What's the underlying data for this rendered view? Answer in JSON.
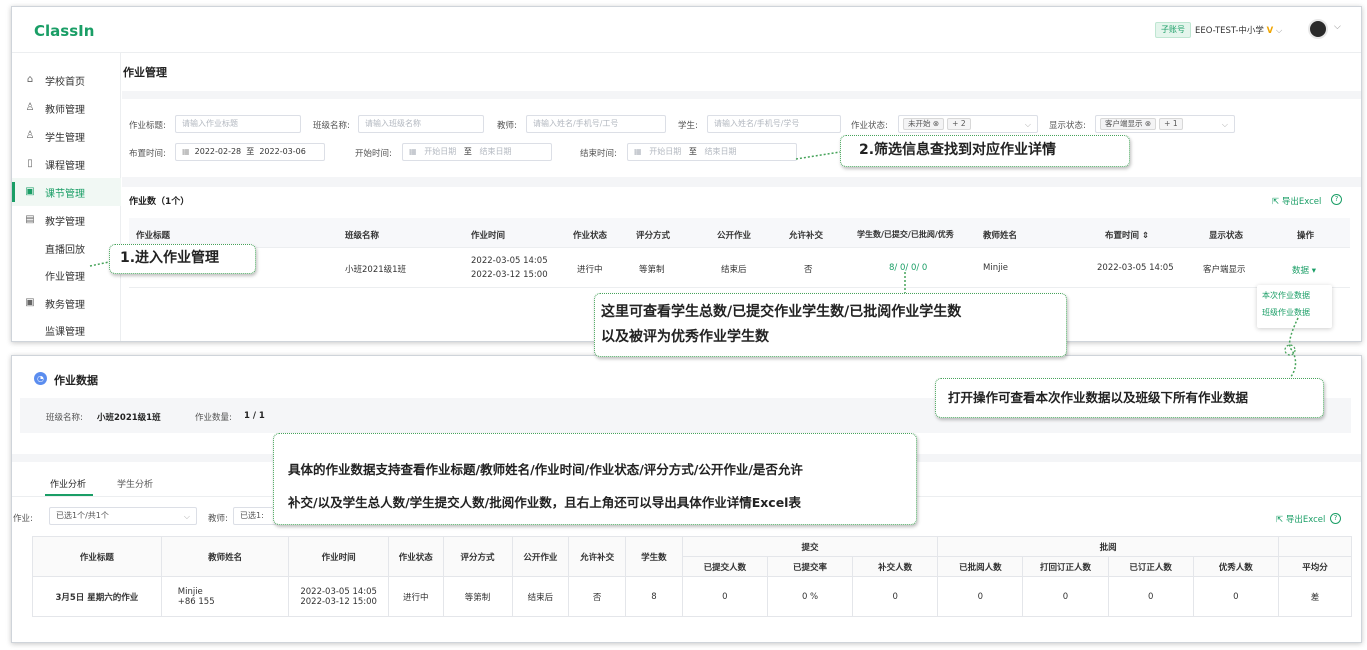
{
  "app": {
    "logo": "ClassIn"
  },
  "topbar": {
    "badge": "子账号",
    "org": "EEO-TEST-中小学",
    "v_mark": "V",
    "chevron": "⌵"
  },
  "sidebar": {
    "items": [
      {
        "label": "学校首页",
        "icon": "home-icon",
        "glyph": "⌂"
      },
      {
        "label": "教师管理",
        "icon": "user-icon",
        "glyph": "♙"
      },
      {
        "label": "学生管理",
        "icon": "users-icon",
        "glyph": "♙"
      },
      {
        "label": "课程管理",
        "icon": "course-icon",
        "glyph": "▯"
      },
      {
        "label": "课节管理",
        "icon": "lesson-icon",
        "glyph": "▣"
      },
      {
        "label": "教学管理",
        "icon": "teach-icon",
        "glyph": "▤"
      },
      {
        "label": "直播回放"
      },
      {
        "label": "作业管理"
      },
      {
        "label": "教务管理",
        "icon": "affairs-icon",
        "glyph": "▣"
      },
      {
        "label": "监课管理"
      }
    ]
  },
  "page": {
    "title": "作业管理"
  },
  "filters": {
    "title_label": "作业标题:",
    "title_ph": "请输入作业标题",
    "class_label": "班级名称:",
    "class_ph": "请输入班级名称",
    "teacher_label": "教师:",
    "teacher_ph": "请输入姓名/手机号/工号",
    "student_label": "学生:",
    "student_ph": "请输入姓名/手机号/学号",
    "status_label": "作业状态:",
    "status_chip": "未开始 ⊗",
    "status_more": "+ 2",
    "display_label": "显示状态:",
    "display_chip": "客户端显示 ⊗",
    "display_more": "+ 1",
    "publish_label": "布置时间:",
    "publish_start": "2022-02-28",
    "to": "至",
    "publish_end": "2022-03-06",
    "start_label": "开始时间:",
    "start_ph": "开始日期",
    "end_ph": "结束日期",
    "finish_label": "结束时间:"
  },
  "list": {
    "count": "作业数（1个）",
    "export": "导出Excel",
    "headers": [
      "作业标题",
      "班级名称",
      "作业时间",
      "作业状态",
      "评分方式",
      "公开作业",
      "允许补交",
      "学生数/已提交/已批阅/优秀",
      "教师姓名",
      "布置时间 ⇕",
      "显示状态",
      "操作"
    ],
    "row": {
      "class": "小班2021级1班",
      "time1": "2022-03-05 14:05",
      "time2": "2022-03-12 15:00",
      "status": "进行中",
      "grading": "等第制",
      "public": "结束后",
      "late": "否",
      "counts": "8/ 0/ 0/ 0",
      "teacher": "Minjie",
      "published": "2022-03-05 14:05",
      "display": "客户端显示",
      "action": "数据 ▾"
    },
    "dropdown": [
      "本次作业数据",
      "班级作业数据"
    ]
  },
  "callouts": {
    "c1": "1.进入作业管理",
    "c2": "2.筛选信息查找到对应作业详情",
    "c3a": "这里可查看学生总数/已提交作业学生数/已批阅作业学生数",
    "c3b": "以及被评为优秀作业学生数",
    "c4": "打开操作可查看本次作业数据以及班级下所有作业数据",
    "c5a": "具体的作业数据支持查看作业标题/教师姓名/作业时间/作业状态/评分方式/公开作业/是否允许",
    "c5b": "补交/以及学生总人数/学生提交人数/批阅作业数，且右上角还可以导出具体作业详情Excel表"
  },
  "data_panel": {
    "title": "作业数据",
    "class_label": "班级名称:",
    "class_value": "小班2021级1班",
    "count_label": "作业数量:",
    "count_value": "1 / 1",
    "tab1": "作业分析",
    "tab2": "学生分析",
    "hw_label": "作业:",
    "hw_value": "已选1个/共1个",
    "teacher_label": "教师:",
    "teacher_value": "已选1:",
    "export": "导出Excel",
    "headers": {
      "title": "作业标题",
      "teacher": "教师姓名",
      "time": "作业时间",
      "status": "作业状态",
      "grading": "评分方式",
      "public": "公开作业",
      "late": "允许补交",
      "students": "学生数",
      "submit": "提交",
      "review": "批阅",
      "avg": "平均分",
      "submitted": "已提交人数",
      "rate": "已提交率",
      "late_count": "补交人数",
      "reviewed": "已批阅人数",
      "returned": "打回订正人数",
      "corrected": "已订正人数",
      "excellent": "优秀人数"
    },
    "row": {
      "title": "3月5日 星期六的作业",
      "teacher1": "Minjie",
      "teacher2": "+86 155",
      "time1": "2022-03-05 14:05",
      "time2": "2022-03-12 15:00",
      "status": "进行中",
      "grading": "等第制",
      "public": "结束后",
      "late": "否",
      "students": "8",
      "submitted": "0",
      "rate": "0 %",
      "late_count": "0",
      "reviewed": "0",
      "returned": "0",
      "corrected": "0",
      "excellent": "0",
      "avg": "差"
    }
  },
  "colors": {
    "accent": "#1a9e66",
    "callout_border": "#46a35a"
  }
}
